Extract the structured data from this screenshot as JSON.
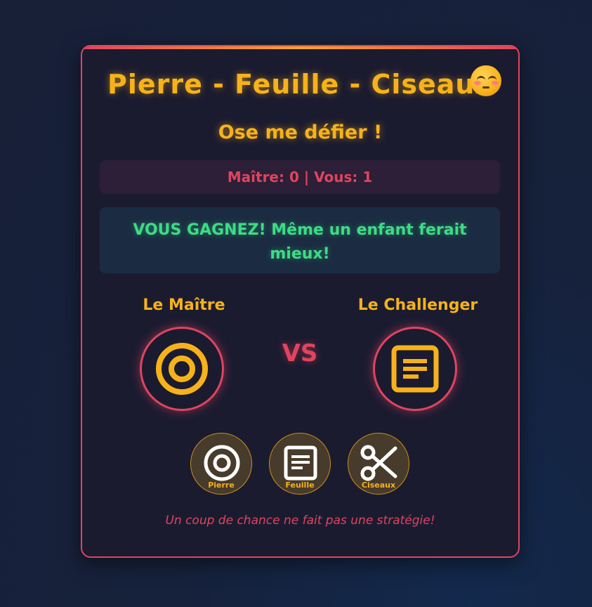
{
  "game": {
    "title": "Pierre - Feuille - Ciseaux",
    "title_emoji": "flushed-face-icon",
    "subtitle": "Ose me défier !",
    "score_text": "Maître: 0 | Vous: 1",
    "scores": {
      "master": 0,
      "player": 1
    },
    "result_message": "VOUS GAGNEZ! Même un enfant ferait mieux!",
    "master_label": "Le Maître",
    "challenger_label": "Le Challenger",
    "vs_label": "VS",
    "master_choice_icon": "rock-icon",
    "challenger_choice_icon": "paper-icon",
    "choices": [
      {
        "label": "Pierre",
        "icon": "rock-icon"
      },
      {
        "label": "Feuille",
        "icon": "paper-icon"
      },
      {
        "label": "Ciseaux",
        "icon": "scissors-icon"
      }
    ],
    "taunt": "Un coup de chance ne fait pas une stratégie!"
  },
  "colors": {
    "accent_gold": "#f7b21a",
    "accent_red": "#e0445f",
    "win_green": "#3ddc84",
    "card_bg": "#1b1b30",
    "page_bg": "#16213b"
  }
}
